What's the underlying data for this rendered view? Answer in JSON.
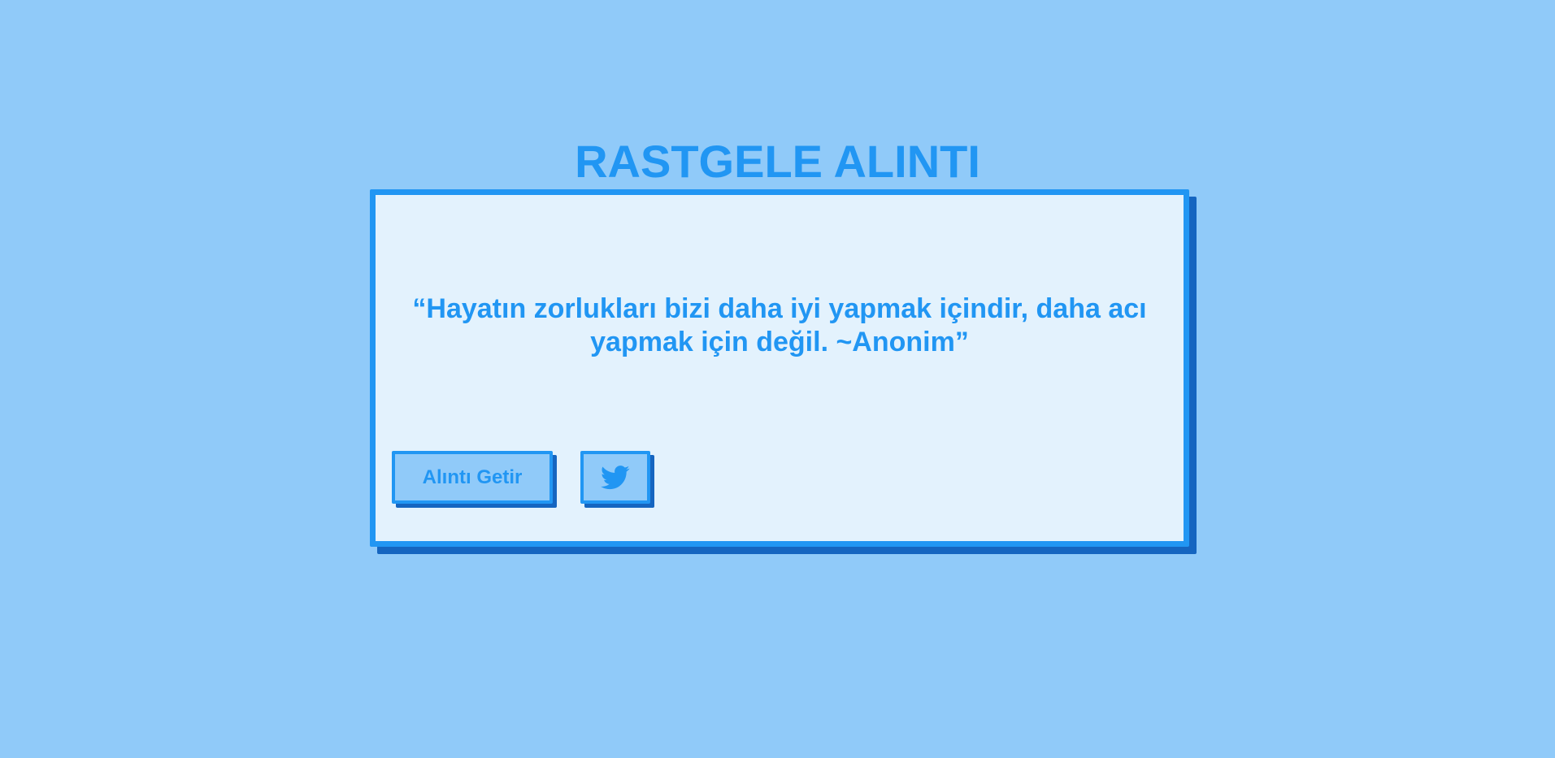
{
  "page": {
    "title": "RASTGELE ALINTI",
    "background_color": "#90caf9"
  },
  "quote_card": {
    "text": "“Hayatın zorlukları bizi daha iyi yapmak içindir, daha acı yapmak için değil. ~Anonim”",
    "accent_color": "#2196f3",
    "shadow_color": "#1565c0",
    "card_background": "#e3f2fd"
  },
  "actions": {
    "new_quote_label": "Alıntı Getir",
    "tweet_icon": "twitter-icon"
  }
}
